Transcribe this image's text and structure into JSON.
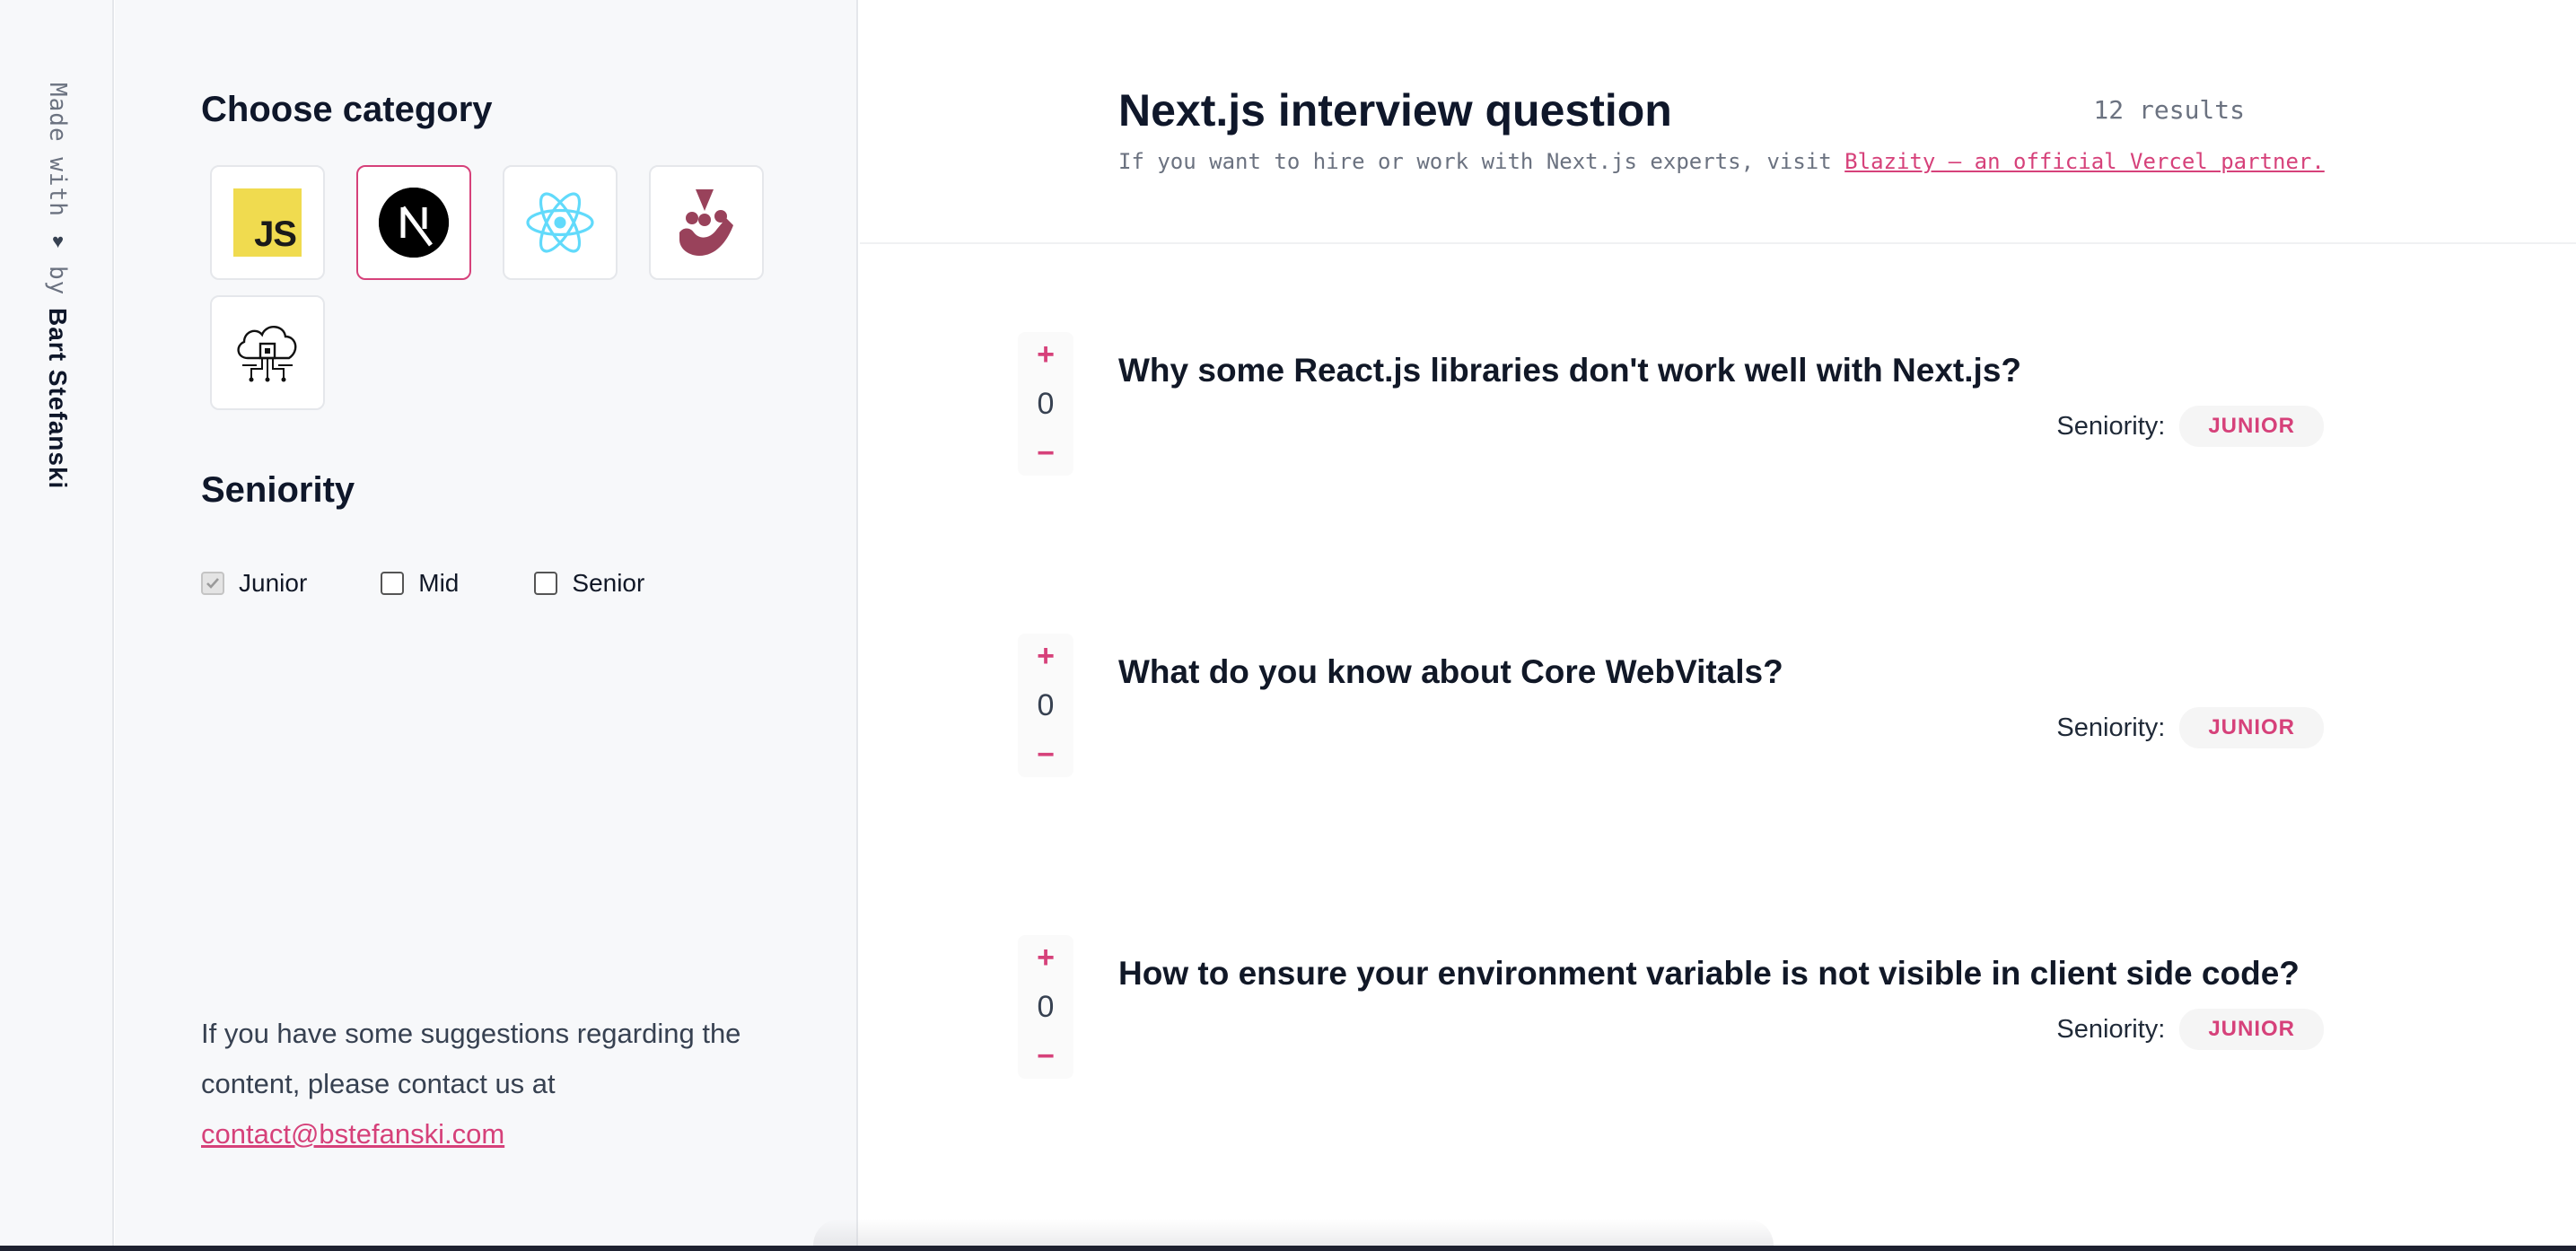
{
  "credit": {
    "made_with": "Made with",
    "heart": "♥",
    "by": "by",
    "author": "Bart Stefanski"
  },
  "sidebar": {
    "category_heading": "Choose category",
    "categories": [
      {
        "name": "javascript",
        "label": "JS",
        "active": false
      },
      {
        "name": "nextjs",
        "label": "N",
        "active": true
      },
      {
        "name": "react",
        "active": false
      },
      {
        "name": "jest",
        "active": false
      },
      {
        "name": "cloud",
        "active": false
      }
    ],
    "seniority_heading": "Seniority",
    "seniority_options": [
      {
        "label": "Junior",
        "checked": true
      },
      {
        "label": "Mid",
        "checked": false
      },
      {
        "label": "Senior",
        "checked": false
      }
    ],
    "contact_text": "If you have some suggestions regarding the content, please contact us at",
    "contact_email": "contact@bstefanski.com"
  },
  "main": {
    "title": "Next.js interview question",
    "results": "12 results",
    "subtitle_prefix": "If you want to hire or work with Next.js experts, visit",
    "subtitle_link": "Blazity – an official Vercel partner.",
    "questions": [
      {
        "title": "Why some React.js libraries don't work well with Next.js?",
        "votes": "0",
        "seniority_label": "Seniority:",
        "seniority": "JUNIOR"
      },
      {
        "title": "What do you know about Core WebVitals?",
        "votes": "0",
        "seniority_label": "Seniority:",
        "seniority": "JUNIOR"
      },
      {
        "title": "How to ensure your environment variable is not visible in client side code?",
        "votes": "0",
        "seniority_label": "Seniority:",
        "seniority": "JUNIOR"
      }
    ],
    "vote_plus": "+",
    "vote_minus": "−"
  },
  "colors": {
    "accent": "#d6417a",
    "text": "#0f172a",
    "sidebar_bg": "#f7f8fa"
  }
}
